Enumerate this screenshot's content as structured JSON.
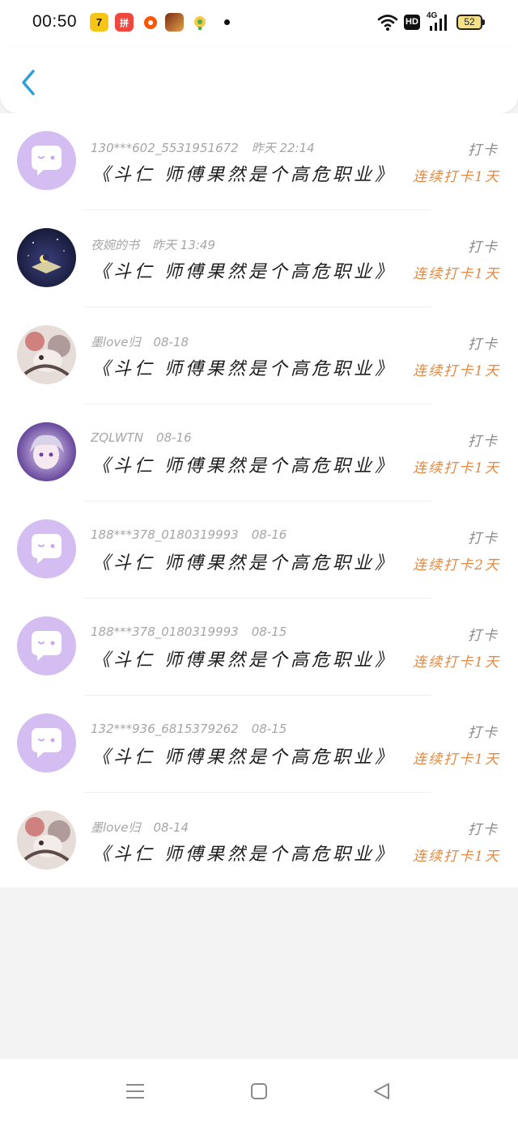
{
  "status_bar": {
    "time": "00:50",
    "battery": "52",
    "signal_label": "4G",
    "hd_label": "HD",
    "app_icons": [
      {
        "name": "app-7-icon",
        "color": "#f5c518",
        "glyph": "7"
      },
      {
        "name": "app-pinduoduo-icon",
        "color": "#f0483e",
        "glyph": "拼"
      },
      {
        "name": "app-taobao-icon",
        "color": "#ff5500",
        "glyph": "•"
      },
      {
        "name": "app-game-icon",
        "color": "#b8532a",
        "glyph": ""
      },
      {
        "name": "app-chat-icon",
        "color": "#f7c948",
        "glyph": "⊙"
      }
    ]
  },
  "header": {
    "back_icon": "chevron-left-icon",
    "accent": "#2a9fd8"
  },
  "items": [
    {
      "name": "130***602_5531951672",
      "time": "昨天 22:14",
      "book": "《斗仁 师傅果然是个高危职业》",
      "action": "打卡",
      "streak": "连续打卡1天",
      "avatar": "default-bubble"
    },
    {
      "name": "夜婉的书",
      "time": "昨天 13:49",
      "book": "《斗仁 师傅果然是个高危职业》",
      "action": "打卡",
      "streak": "连续打卡1天",
      "avatar": "night-book"
    },
    {
      "name": "墨love归",
      "time": "08-18",
      "book": "《斗仁 师傅果然是个高危职业》",
      "action": "打卡",
      "streak": "连续打卡1天",
      "avatar": "anime-floral"
    },
    {
      "name": "ZQLWTN",
      "time": "08-16",
      "book": "《斗仁 师傅果然是个高危职业》",
      "action": "打卡",
      "streak": "连续打卡1天",
      "avatar": "anime-purple"
    },
    {
      "name": "188***378_0180319993",
      "time": "08-16",
      "book": "《斗仁 师傅果然是个高危职业》",
      "action": "打卡",
      "streak": "连续打卡2天",
      "avatar": "default-bubble"
    },
    {
      "name": "188***378_0180319993",
      "time": "08-15",
      "book": "《斗仁 师傅果然是个高危职业》",
      "action": "打卡",
      "streak": "连续打卡1天",
      "avatar": "default-bubble"
    },
    {
      "name": "132***936_6815379262",
      "time": "08-15",
      "book": "《斗仁 师傅果然是个高危职业》",
      "action": "打卡",
      "streak": "连续打卡1天",
      "avatar": "default-bubble"
    },
    {
      "name": "墨love归",
      "time": "08-14",
      "book": "《斗仁 师傅果然是个高危职业》",
      "action": "打卡",
      "streak": "连续打卡1天",
      "avatar": "anime-floral"
    }
  ],
  "colors": {
    "streak": "#e08a47",
    "avatar_default_bg": "#d4bdf0",
    "meta_text": "#a6a6a6"
  },
  "nav": [
    {
      "name": "menu-icon"
    },
    {
      "name": "home-icon"
    },
    {
      "name": "back-triangle-icon"
    }
  ]
}
